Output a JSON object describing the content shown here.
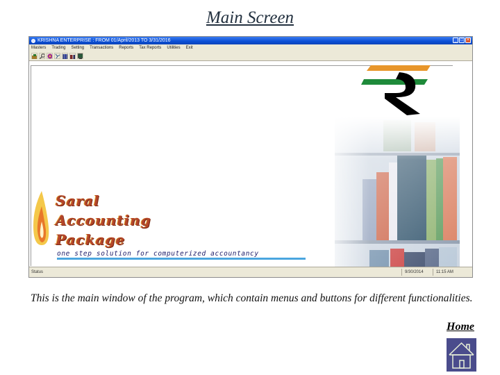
{
  "slide": {
    "title": "Main Screen",
    "description": "This is the main window of the program, which contain menus and buttons for different functionalities.",
    "home_link": "Home",
    "home_icon": "house-icon"
  },
  "app_window": {
    "title": "KRISHNA ENTERPRISE : FROM 01/April/2013 TO 3/31/2016",
    "window_controls": {
      "minimize": "_",
      "maximize": "□",
      "close": "×"
    },
    "menu": [
      "Masters",
      "Trading",
      "Setting",
      "Transactions",
      "Reports",
      "Tax Reports",
      "Utilities",
      "Exit"
    ],
    "toolbar_icons": [
      "company-icon",
      "search-icon",
      "flower-icon",
      "tool-icon",
      "books-icon",
      "users-icon",
      "screen-icon"
    ],
    "branding": {
      "line1": "Saral",
      "line2": "Accounting",
      "line3": "Package",
      "tagline": "one step solution for computerized accountancy",
      "logo": "rupee-symbol"
    },
    "statusbar": {
      "text": "Status",
      "date": "9/30/2014",
      "time": "11:15 AM"
    }
  },
  "colors": {
    "titlebar": "#0a4fd6",
    "saffron": "#e8962a",
    "green": "#1e8a3a",
    "home_button": "#4a4c8c"
  }
}
